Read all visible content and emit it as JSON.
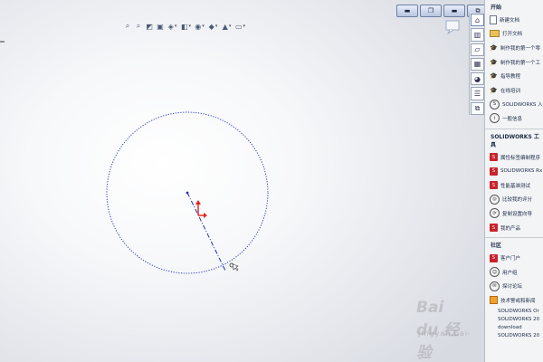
{
  "window": {
    "controls": [
      "▬",
      "❐",
      "▬",
      "⧉",
      "✕"
    ]
  },
  "heads_up_toolbar": {
    "icons": [
      "zoom-to-fit-icon",
      "zoom-area-icon",
      "previous-view-icon",
      "section-view-icon",
      "view-orientation-icon",
      "display-style-icon",
      "hide-show-icon",
      "edit-appearance-icon",
      "apply-scene-icon",
      "view-settings-icon"
    ]
  },
  "taskpane": {
    "tabs": [
      "home-icon",
      "design-library-icon",
      "file-explorer-icon",
      "view-palette-icon",
      "appearances-icon",
      "custom-properties-icon",
      "forum-icon"
    ],
    "section_start": {
      "title": "开始",
      "items": [
        {
          "icon": "new-document-icon",
          "label": "新建文档"
        },
        {
          "icon": "open-folder-icon",
          "label": "打开文档"
        },
        {
          "icon": "graduation-cap-icon",
          "label": "制作我的第一个零"
        },
        {
          "icon": "graduation-cap-icon",
          "label": "制作我的第一个工"
        },
        {
          "icon": "graduation-cap-icon",
          "label": "指导教程"
        },
        {
          "icon": "graduation-cap-icon",
          "label": "在线培训"
        },
        {
          "icon": "solidworks-logo-icon",
          "label": "SOLIDWORKS 入门"
        },
        {
          "icon": "info-icon",
          "label": "一般信息"
        }
      ]
    },
    "section_tools": {
      "title": "SOLIDWORKS 工具",
      "items": [
        {
          "icon": "solidworks-tool-icon",
          "label": "属性标签编制程序"
        },
        {
          "icon": "solidworks-tool-icon",
          "label": "SOLIDWORKS Rx"
        },
        {
          "icon": "solidworks-tool-icon",
          "label": "性能基准测试"
        },
        {
          "icon": "compare-score-icon",
          "label": "比较我的评分"
        },
        {
          "icon": "copy-settings-icon",
          "label": "复制设置向导"
        },
        {
          "icon": "my-products-icon",
          "label": "我的产品"
        }
      ]
    },
    "section_community": {
      "title": "社区",
      "items": [
        {
          "icon": "customer-portal-icon",
          "label": "客户门户"
        },
        {
          "icon": "user-group-icon",
          "label": "用户组"
        },
        {
          "icon": "forum-icon",
          "label": "探讨论坛"
        },
        {
          "icon": "rss-icon",
          "label": "技术警戒和新闻"
        }
      ],
      "extra_lines": [
        "SOLIDWORKS Or",
        "SOLIDWORKS 20",
        "download",
        "SOLIDWORKS 20"
      ]
    }
  },
  "watermark": {
    "text": "Bai du 经验",
    "sub": "jingyan.baidu.com"
  },
  "colors": {
    "sketch_circle": "#2d39c8",
    "centerline": "#1f2bb8",
    "origin_arrow": "#e3231b",
    "close_button": "#c63c28"
  }
}
